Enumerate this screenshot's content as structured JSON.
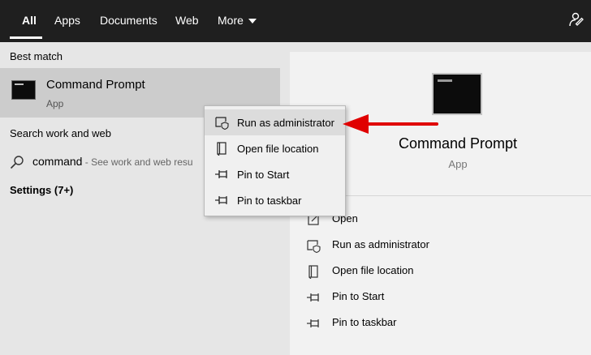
{
  "tabs": [
    {
      "label": "All",
      "active": true
    },
    {
      "label": "Apps"
    },
    {
      "label": "Documents"
    },
    {
      "label": "Web"
    },
    {
      "label": "More"
    }
  ],
  "icons": {
    "feedback": "feedback-icon",
    "more_caret": "chevron-down-icon",
    "search": "search-icon",
    "app": "command-prompt-icon"
  },
  "left": {
    "best_match_label": "Best match",
    "best_match": {
      "title": "Command Prompt",
      "subtitle": "App"
    },
    "search_web_label": "Search work and web",
    "search_query": "command",
    "search_hint": " - See work and web resu",
    "settings_label": "Settings (7+)"
  },
  "context_menu": {
    "items": [
      {
        "label": "Run as administrator",
        "icon": "shield-icon",
        "highlighted": true
      },
      {
        "label": "Open file location",
        "icon": "file-location-icon"
      },
      {
        "label": "Pin to Start",
        "icon": "pin-icon"
      },
      {
        "label": "Pin to taskbar",
        "icon": "pin-icon"
      }
    ]
  },
  "detail": {
    "title": "Command Prompt",
    "subtitle": "App",
    "actions": [
      {
        "label": "Open",
        "icon": "open-icon"
      },
      {
        "label": "Run as administrator",
        "icon": "shield-icon"
      },
      {
        "label": "Open file location",
        "icon": "file-location-icon"
      },
      {
        "label": "Pin to Start",
        "icon": "pin-icon"
      },
      {
        "label": "Pin to taskbar",
        "icon": "pin-icon"
      }
    ]
  },
  "colors": {
    "topbar": "#1f1f1f",
    "left_bg": "#e6e6e6",
    "selected_row": "#cccccc",
    "detail_bg": "#f2f2f2",
    "annotation_arrow": "#e00000"
  }
}
